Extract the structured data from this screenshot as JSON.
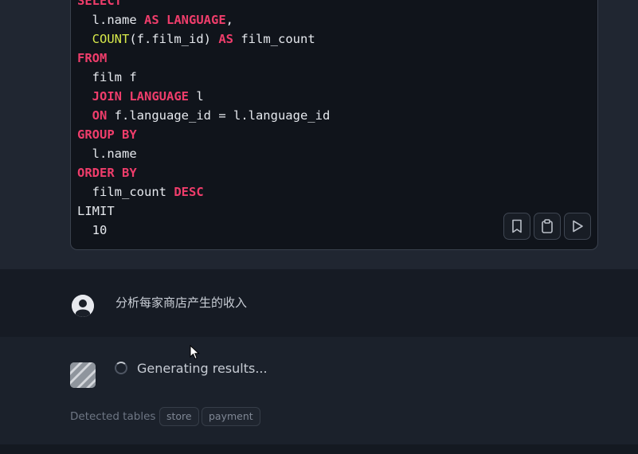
{
  "code_block": {
    "lines": [
      [
        {
          "t": "SELECT",
          "k": "kw"
        }
      ],
      [
        {
          "t": "  l.name ",
          "k": "plain"
        },
        {
          "t": "AS",
          "k": "kw"
        },
        {
          "t": " ",
          "k": "plain"
        },
        {
          "t": "LANGUAGE",
          "k": "kw"
        },
        {
          "t": ",",
          "k": "plain"
        }
      ],
      [
        {
          "t": "  ",
          "k": "plain"
        },
        {
          "t": "COUNT",
          "k": "fn"
        },
        {
          "t": "(f.film_id) ",
          "k": "plain"
        },
        {
          "t": "AS",
          "k": "kw"
        },
        {
          "t": " film_count",
          "k": "plain"
        }
      ],
      [
        {
          "t": "FROM",
          "k": "kw"
        }
      ],
      [
        {
          "t": "  film f",
          "k": "plain"
        }
      ],
      [
        {
          "t": "  ",
          "k": "plain"
        },
        {
          "t": "JOIN",
          "k": "kw"
        },
        {
          "t": " ",
          "k": "plain"
        },
        {
          "t": "LANGUAGE",
          "k": "kw"
        },
        {
          "t": " l",
          "k": "plain"
        }
      ],
      [
        {
          "t": "  ",
          "k": "plain"
        },
        {
          "t": "ON",
          "k": "kw"
        },
        {
          "t": " f.language_id = l.language_id",
          "k": "plain"
        }
      ],
      [
        {
          "t": "GROUP BY",
          "k": "kw"
        }
      ],
      [
        {
          "t": "  l.name",
          "k": "plain"
        }
      ],
      [
        {
          "t": "ORDER BY",
          "k": "kw"
        }
      ],
      [
        {
          "t": "  film_count ",
          "k": "plain"
        },
        {
          "t": "DESC",
          "k": "kw"
        }
      ],
      [
        {
          "t": "LIMIT",
          "k": "plain"
        }
      ],
      [
        {
          "t": "  10",
          "k": "plain"
        }
      ]
    ],
    "actions": [
      {
        "name": "bookmark-button",
        "icon": "bookmark-icon"
      },
      {
        "name": "copy-button",
        "icon": "clipboard-icon"
      },
      {
        "name": "run-button",
        "icon": "play-icon"
      }
    ]
  },
  "user_message": {
    "text": "分析每家商店产生的收入"
  },
  "assistant": {
    "status_text": "Generating results...",
    "detected_label": "Detected tables",
    "tables": [
      "store",
      "payment"
    ]
  },
  "colors": {
    "keyword": "#ef3d6b",
    "function": "#d6e84a",
    "code_bg": "#10141b"
  }
}
